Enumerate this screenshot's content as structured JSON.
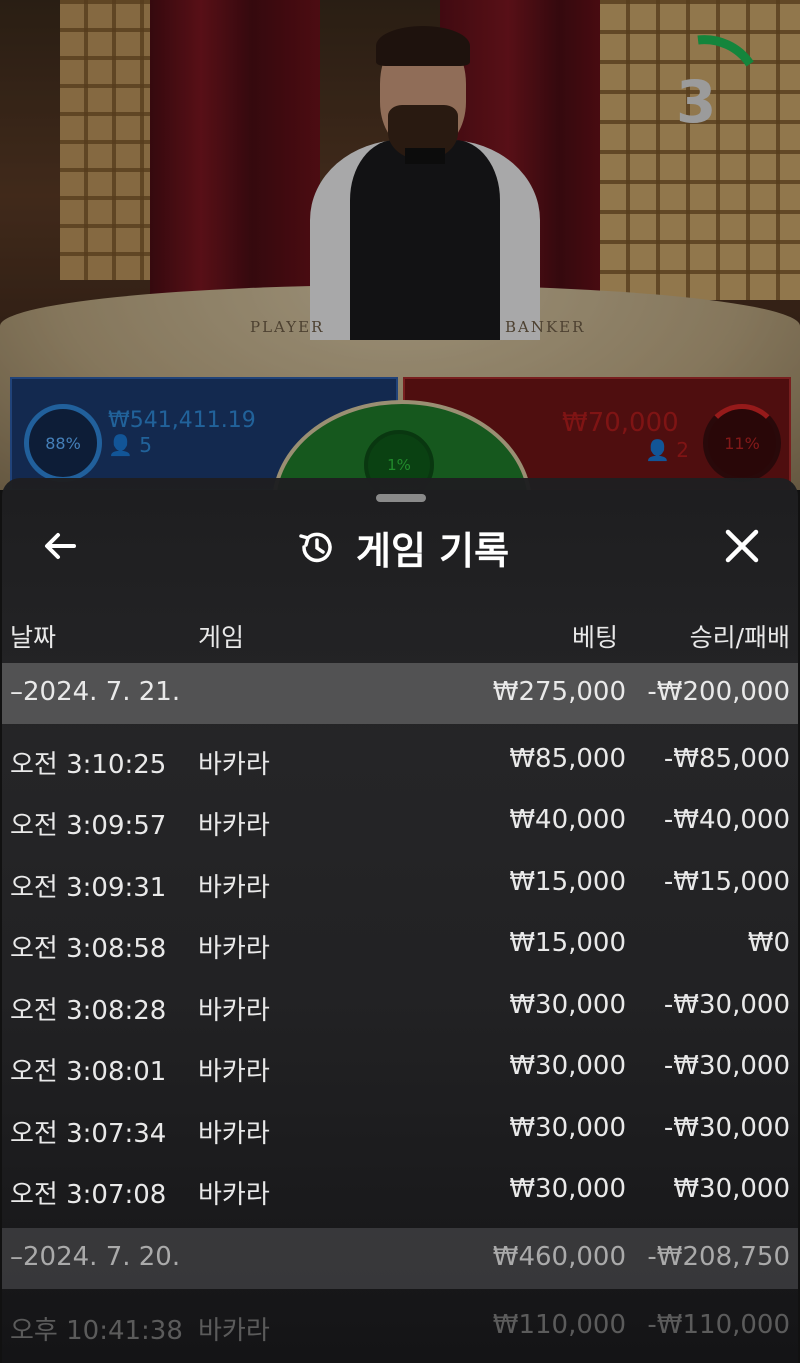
{
  "video": {
    "timer": "3",
    "table_labels": {
      "player": "PLAYER",
      "banker": "BANKER"
    },
    "player_bet": {
      "percent": "88%",
      "amount": "₩541,411.19",
      "count": "5"
    },
    "banker_bet": {
      "percent": "11%",
      "amount": "₩70,000",
      "count": "2"
    },
    "tie_bet": {
      "percent": "1%"
    }
  },
  "sheet": {
    "title": "게임 기록",
    "back_icon": "arrow-left-icon",
    "close_icon": "close-icon",
    "columns": {
      "date": "날짜",
      "game": "게임",
      "bet": "베팅",
      "winloss": "승리/패배"
    },
    "groups": [
      {
        "date": "–2024. 7. 21.",
        "total_bet": "₩275,000",
        "total_winloss": "-₩200,000",
        "rows": [
          {
            "time": "오전 3:10:25",
            "game": "바카라",
            "bet": "₩85,000",
            "winloss": "-₩85,000"
          },
          {
            "time": "오전 3:09:57",
            "game": "바카라",
            "bet": "₩40,000",
            "winloss": "-₩40,000"
          },
          {
            "time": "오전 3:09:31",
            "game": "바카라",
            "bet": "₩15,000",
            "winloss": "-₩15,000"
          },
          {
            "time": "오전 3:08:58",
            "game": "바카라",
            "bet": "₩15,000",
            "winloss": "₩0"
          },
          {
            "time": "오전 3:08:28",
            "game": "바카라",
            "bet": "₩30,000",
            "winloss": "-₩30,000"
          },
          {
            "time": "오전 3:08:01",
            "game": "바카라",
            "bet": "₩30,000",
            "winloss": "-₩30,000"
          },
          {
            "time": "오전 3:07:34",
            "game": "바카라",
            "bet": "₩30,000",
            "winloss": "-₩30,000"
          },
          {
            "time": "오전 3:07:08",
            "game": "바카라",
            "bet": "₩30,000",
            "winloss": "₩30,000"
          }
        ]
      },
      {
        "date": "–2024. 7. 20.",
        "total_bet": "₩460,000",
        "total_winloss": "-₩208,750",
        "rows": [
          {
            "time": "오후 10:41:38",
            "game": "바카라",
            "bet": "₩110,000",
            "winloss": "-₩110,000"
          }
        ]
      }
    ]
  }
}
